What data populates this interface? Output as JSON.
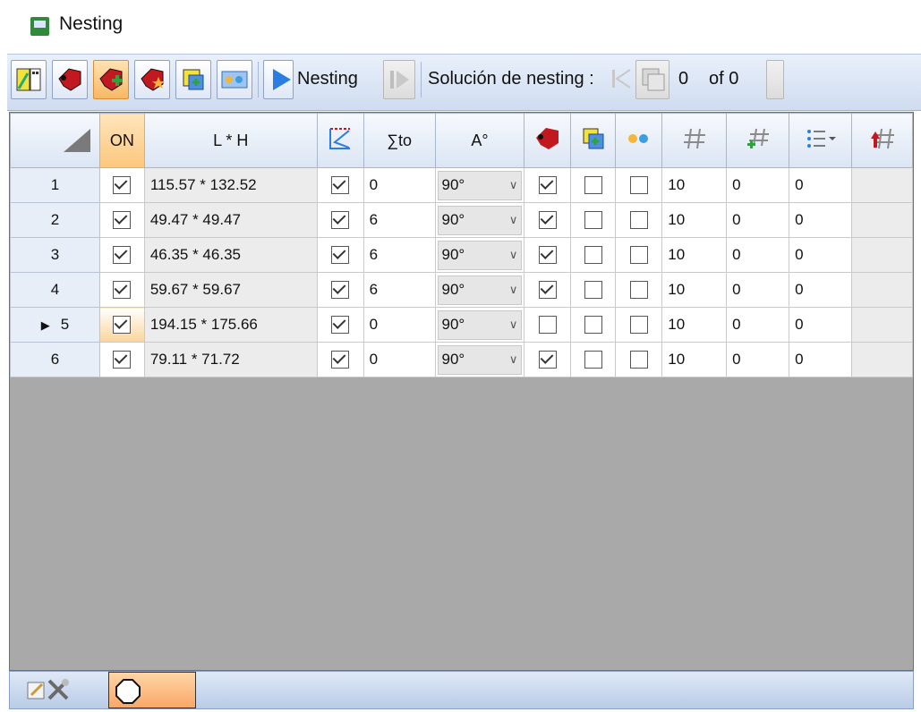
{
  "window": {
    "title": "Nesting"
  },
  "toolbar": {
    "nesting_label": "Nesting",
    "solution_label": "Solución de nesting :",
    "solution_index": "0",
    "solution_total": "of 0"
  },
  "columns": [
    "ON",
    "L * H",
    "∑to",
    "A°"
  ],
  "rows": [
    {
      "num": "1",
      "on": true,
      "lh": "115.57 * 132.52",
      "chk1": true,
      "sum": "0",
      "angle": "90°",
      "c1": true,
      "c2": false,
      "c3": false,
      "n1": "10",
      "n2": "0",
      "n3": "0"
    },
    {
      "num": "2",
      "on": true,
      "lh": "49.47 * 49.47",
      "chk1": true,
      "sum": "6",
      "angle": "90°",
      "c1": true,
      "c2": false,
      "c3": false,
      "n1": "10",
      "n2": "0",
      "n3": "0"
    },
    {
      "num": "3",
      "on": true,
      "lh": "46.35 * 46.35",
      "chk1": true,
      "sum": "6",
      "angle": "90°",
      "c1": true,
      "c2": false,
      "c3": false,
      "n1": "10",
      "n2": "0",
      "n3": "0"
    },
    {
      "num": "4",
      "on": true,
      "lh": "59.67 * 59.67",
      "chk1": true,
      "sum": "6",
      "angle": "90°",
      "c1": true,
      "c2": false,
      "c3": false,
      "n1": "10",
      "n2": "0",
      "n3": "0"
    },
    {
      "num": "5",
      "on": true,
      "lh": "194.15 * 175.66",
      "chk1": true,
      "sum": "0",
      "angle": "90°",
      "c1": false,
      "c2": false,
      "c3": false,
      "n1": "10",
      "n2": "0",
      "n3": "0",
      "selected": true
    },
    {
      "num": "6",
      "on": true,
      "lh": "79.11 * 71.72",
      "chk1": true,
      "sum": "0",
      "angle": "90°",
      "c1": true,
      "c2": false,
      "c3": false,
      "n1": "10",
      "n2": "0",
      "n3": "0"
    }
  ],
  "colors": {
    "accent": "#f7b765",
    "grid_bg": "#a9a9a9",
    "header": "#dbe5f3"
  }
}
